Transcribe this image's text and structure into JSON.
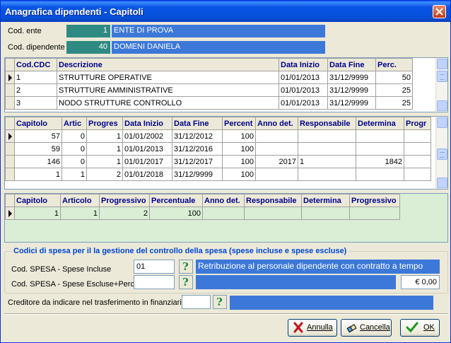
{
  "window": {
    "title": "Anagrafica dipendenti - Capitoli"
  },
  "header": {
    "ente_label": "Cod. ente",
    "ente_code": "1",
    "ente_name": "ENTE DI PROVA",
    "dip_label": "Cod. dipendente",
    "dip_code": "40",
    "dip_name": "DOMENI DANIELA"
  },
  "cdc_grid": {
    "columns": [
      "Cod.CDC",
      "Descrizione",
      "Data Inizio",
      "Data Fine",
      "Perc."
    ],
    "rows": [
      [
        "1",
        "STRUTTURE OPERATIVE",
        "01/01/2013",
        "31/12/9999",
        "50"
      ],
      [
        "2",
        "STRUTTURE AMMINISTRATIVE",
        "01/01/2013",
        "31/12/9999",
        "25"
      ],
      [
        "3",
        "NODO STRUTTURE CONTROLLO",
        "01/01/2013",
        "31/12/9999",
        "25"
      ]
    ]
  },
  "capitoli_grid": {
    "columns": [
      "Capitolo",
      "Artic",
      "Progres",
      "Data Inizio",
      "Data Fine",
      "Percent",
      "Anno det.",
      "Responsabile",
      "Determina",
      "Progr"
    ],
    "rows": [
      [
        "57",
        "0",
        "1",
        "01/01/2002",
        "31/12/2012",
        "100",
        "",
        "",
        "",
        ""
      ],
      [
        "59",
        "0",
        "1",
        "01/01/2013",
        "31/12/2016",
        "100",
        "",
        "",
        "",
        ""
      ],
      [
        "146",
        "0",
        "1",
        "01/01/2017",
        "31/12/2017",
        "100",
        "2017",
        "1",
        "1842",
        ""
      ],
      [
        "1",
        "1",
        "2",
        "01/01/2018",
        "31/12/9999",
        "100",
        "",
        "",
        "",
        ""
      ]
    ]
  },
  "sub_grid": {
    "columns": [
      "Capitolo",
      "Articolo",
      "Progressivo",
      "Percentuale",
      "Anno det.",
      "Responsabile",
      "Determina",
      "Progressivo"
    ],
    "rows": [
      [
        "1",
        "1",
        "2",
        "100",
        "",
        "",
        "",
        ""
      ]
    ]
  },
  "spesa_group": {
    "legend": "Codici di spesa per il la gestione del controllo della spesa (spese incluse e spese escluse)",
    "incluse_label": "Cod. SPESA - Spese Incluse",
    "incluse_value": "01",
    "incluse_desc": "Retribuzione al personale dipendente con contratto a tempo",
    "escluse_label": "Cod. SPESA - Spese Escluse+Perc.",
    "escluse_value": "",
    "escluse_desc": "",
    "escluse_amount": "€ 0,00"
  },
  "creditore": {
    "label": "Creditore da indicare nel trasferimento in finanziaria",
    "value": "",
    "desc": ""
  },
  "buttons": {
    "annulla": "Annulla",
    "cancella": "Cancella",
    "ok": "OK"
  },
  "colors": {
    "accent": "#3c78d8",
    "code_box": "#2e8a82",
    "sub_grid_bg": "#d9eed5"
  }
}
